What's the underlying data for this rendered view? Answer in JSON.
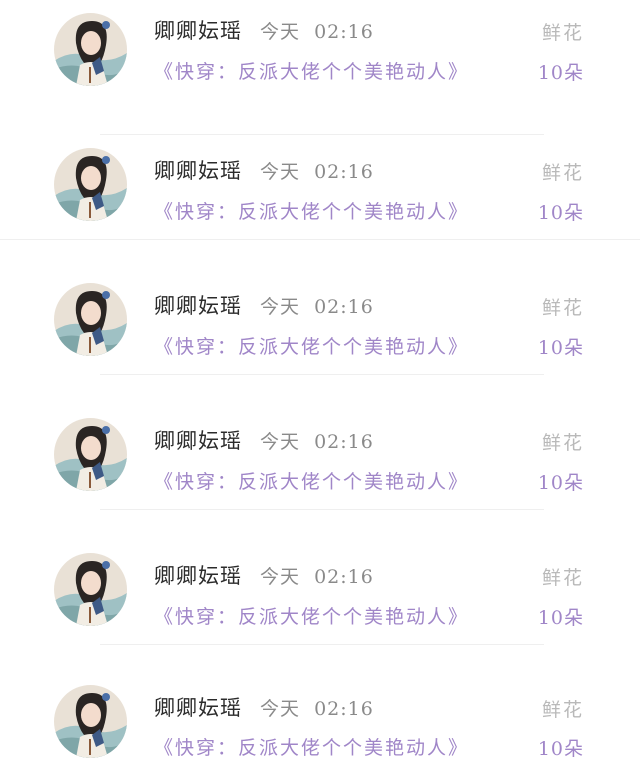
{
  "rows": [
    {
      "name": "卿卿妘瑶",
      "time": "今天  02:16",
      "book": "《快穿：反派大佬个个美艳动人》",
      "gift": "鲜花",
      "count": "10朵"
    },
    {
      "name": "卿卿妘瑶",
      "time": "今天  02:16",
      "book": "《快穿：反派大佬个个美艳动人》",
      "gift": "鲜花",
      "count": "10朵"
    },
    {
      "name": "卿卿妘瑶",
      "time": "今天  02:16",
      "book": "《快穿：反派大佬个个美艳动人》",
      "gift": "鲜花",
      "count": "10朵"
    },
    {
      "name": "卿卿妘瑶",
      "time": "今天  02:16",
      "book": "《快穿：反派大佬个个美艳动人》",
      "gift": "鲜花",
      "count": "10朵"
    },
    {
      "name": "卿卿妘瑶",
      "time": "今天  02:16",
      "book": "《快穿：反派大佬个个美艳动人》",
      "gift": "鲜花",
      "count": "10朵"
    },
    {
      "name": "卿卿妘瑶",
      "time": "今天  02:16",
      "book": "《快穿：反派大佬个个美艳动人》",
      "gift": "鲜花",
      "count": "10朵"
    }
  ],
  "colors": {
    "name": "#2b2b2b",
    "time": "#8a8a8a",
    "accent": "#a086c8",
    "gift": "#b9b9b9"
  },
  "icons": {
    "avatar": "illustrated-girl-avatar"
  }
}
